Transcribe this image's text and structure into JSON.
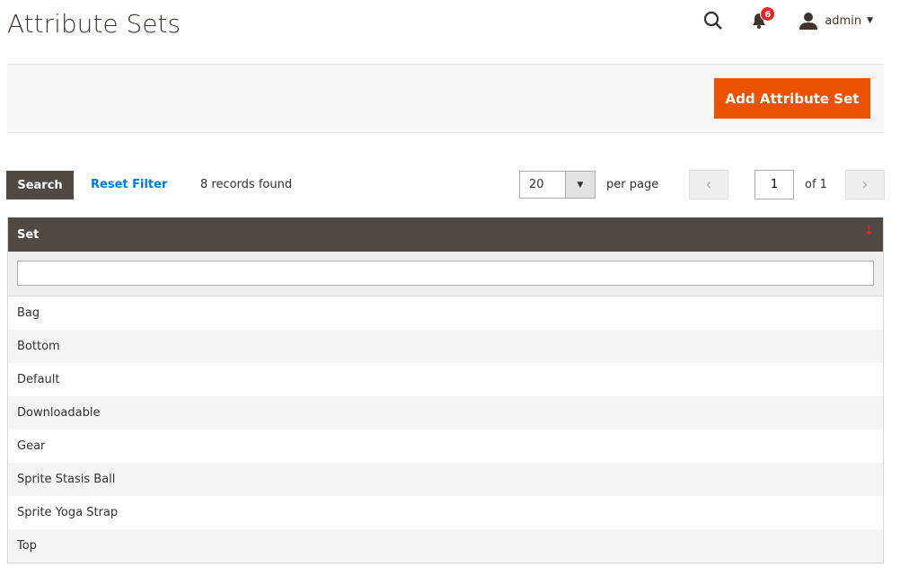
{
  "header": {
    "title": "Attribute Sets",
    "notifications_count": "6",
    "user": "admin"
  },
  "actions": {
    "add_label": "Add Attribute Set"
  },
  "grid": {
    "search_label": "Search",
    "reset_label": "Reset Filter",
    "records": "8 records found",
    "per_page_value": "20",
    "per_page_label": "per page",
    "page": "1",
    "of_label": "of 1"
  },
  "table": {
    "column": "Set",
    "sort_direction": "descending",
    "filter_value": "",
    "rows": [
      "Bag",
      "Bottom",
      "Default",
      "Downloadable",
      "Gear",
      "Sprite Stasis Ball",
      "Sprite Yoga Strap",
      "Top"
    ]
  },
  "colors": {
    "accent": "#eb5202",
    "header_bg": "#514943",
    "link": "#007bdb",
    "badge": "#e22626"
  }
}
